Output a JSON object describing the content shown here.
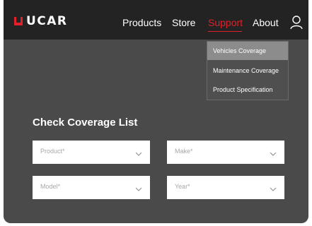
{
  "brand": {
    "name": "UCAR",
    "accent": "#e0202a"
  },
  "nav": {
    "items": [
      {
        "label": "Products"
      },
      {
        "label": "Store"
      },
      {
        "label": "Support"
      },
      {
        "label": "About"
      }
    ],
    "active": "Support",
    "user_icon": "user-icon"
  },
  "support_menu": {
    "items": [
      {
        "label": "Vehicles Coverage"
      },
      {
        "label": "Maintenance Coverage"
      },
      {
        "label": "Product Specification"
      }
    ],
    "hovered": "Vehicles Coverage"
  },
  "coverage": {
    "title": "Check Coverage List",
    "fields": [
      {
        "placeholder": "Product*"
      },
      {
        "placeholder": "Make*"
      },
      {
        "placeholder": "Model*"
      },
      {
        "placeholder": "Year*"
      }
    ],
    "chevron_icon": "chevron-down-icon"
  }
}
